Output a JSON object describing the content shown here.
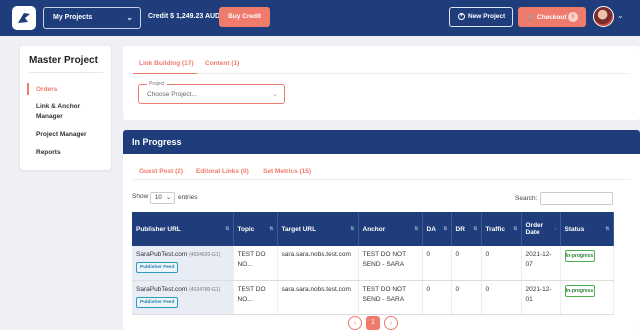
{
  "header": {
    "project_selector": "My Projects",
    "credit": "Credit $ 1,249.23 AUD",
    "buy_credit": "Buy Credit",
    "new_project": "New Project",
    "checkout": "Checkout",
    "checkout_count": "0"
  },
  "sidebar": {
    "title": "Master Project",
    "items": [
      {
        "label": "Orders"
      },
      {
        "label": "Link & Anchor"
      },
      {
        "label": "Manager"
      },
      {
        "label": "Project Manager"
      },
      {
        "label": "Reports"
      }
    ]
  },
  "filter": {
    "tabs": [
      "Link Building (17)",
      "Content (1)"
    ],
    "project_label": "Project",
    "project_placeholder": "Choose Project..."
  },
  "progress": {
    "title": "In Progress",
    "tabs": [
      "Guest Post (2)",
      "Editoral Links (0)",
      "Set Metrics (15)"
    ],
    "show_label": "Show",
    "show_value": "10",
    "entries_label": "entries",
    "search_label": "Search:",
    "columns": [
      "Publisher URL",
      "Topic",
      "Target URL",
      "Anchor",
      "DA",
      "DR",
      "Traffic",
      "Order Date",
      "Status"
    ],
    "rows": [
      {
        "publisher": "SaraPubTest.com",
        "publisher_id": "(4024920-G1)",
        "feed": "Publisher Feed",
        "topic": "TEST DO NO...",
        "target": "sara.sara.nobs.test.com",
        "anchor": "TEST DO NOT SEND - SARA",
        "da": "0",
        "dr": "0",
        "traffic": "0",
        "date": "2021-12-07",
        "status": "In-progress"
      },
      {
        "publisher": "SaraPubTest.com",
        "publisher_id": "(4024780-G1)",
        "feed": "Publisher Feed",
        "topic": "TEST DO NO...",
        "target": "sara.sara.nobs.test.com",
        "anchor": "TEST DO NOT SEND - SARA",
        "da": "0",
        "dr": "0",
        "traffic": "0",
        "date": "2021-12-01",
        "status": "In-progress"
      }
    ],
    "pager": {
      "prev": "‹",
      "current": "1",
      "next": "›"
    }
  }
}
